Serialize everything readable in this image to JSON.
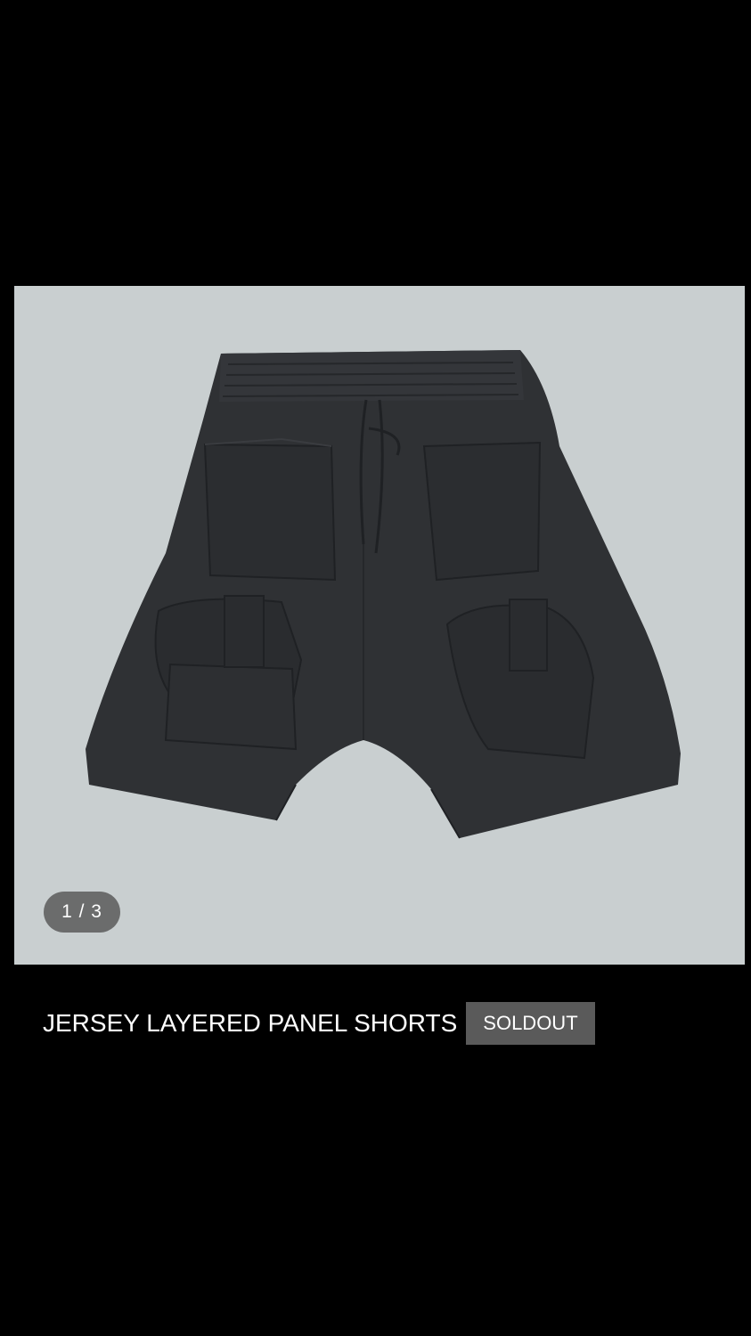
{
  "gallery": {
    "counter": "1 / 3",
    "image_alt": "shorts-photo"
  },
  "product": {
    "title": "JERSEY LAYERED PANEL SHORTS",
    "badge": "SOLDOUT"
  },
  "colors": {
    "page_background": "#000000",
    "image_background": "#c9cfd0",
    "garment": "#2f3134",
    "badge_background": "#5a5a5a",
    "text": "#ffffff"
  }
}
